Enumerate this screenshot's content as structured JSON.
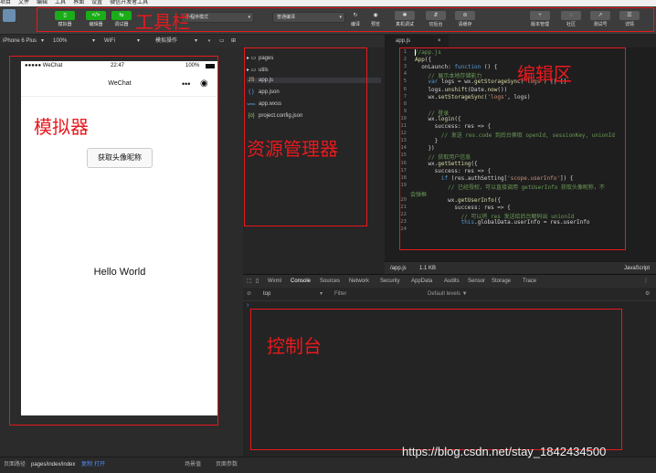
{
  "menubar": {
    "items": [
      "项目",
      "文件",
      "编辑",
      "工具",
      "界面",
      "设置",
      "微信开发者工具"
    ]
  },
  "toolbar": {
    "buttons": [
      {
        "label": "模拟器",
        "icon": "phone-icon"
      },
      {
        "label": "编辑器",
        "icon": "code-icon"
      },
      {
        "label": "调试器",
        "icon": "debug-icon"
      }
    ],
    "mode_select": "小程序模式",
    "compile_select": "普通编译",
    "compile_label": "编译",
    "preview_label": "预览",
    "remote_debug_label": "真机调试",
    "background_label": "切后台",
    "cache_label": "清缓存",
    "version_label": "版本管理",
    "community_label": "社区",
    "test_label": "测试号",
    "details_label": "详情"
  },
  "subbar": {
    "device": "iPhone 6 Plus",
    "zoom": "100%",
    "network": "WiFi",
    "sim_ops": "模拟操作"
  },
  "phone": {
    "carrier": "●●●●● WeChat",
    "time": "22:47",
    "battery": "100%",
    "nav_title": "WeChat",
    "avatar_button": "获取头像昵称",
    "hello": "Hello World"
  },
  "explorer": {
    "items": [
      {
        "name": "pages",
        "type": "folder"
      },
      {
        "name": "utils",
        "type": "folder"
      },
      {
        "name": "app.js",
        "type": "js"
      },
      {
        "name": "app.json",
        "type": "json"
      },
      {
        "name": "app.wxss",
        "type": "wxss"
      },
      {
        "name": "project.config.json",
        "type": "config"
      }
    ],
    "icons": {
      "folder": "▸",
      "js": "JS",
      "json": "{ }",
      "wxss": "wxss",
      "config": "{o}"
    }
  },
  "editor": {
    "tab": "app.js",
    "status_path": "/app.js",
    "status_size": "1.1 KB",
    "status_lang": "JavaScript",
    "lines": [
      "//app.js",
      "App({",
      "  onLaunch: function () {",
      "    // 展示本地存储能力",
      "    var logs = wx.getStorageSync('logs') || []",
      "    logs.unshift(Date.now())",
      "    wx.setStorageSync('logs', logs)",
      "",
      "    // 登录",
      "    wx.login({",
      "      success: res => {",
      "        // 发送 res.code 到后台换取 openId, sessionKey, unionId",
      "      }",
      "    })",
      "    // 获取用户信息",
      "    wx.getSetting({",
      "      success: res => {",
      "        if (res.authSetting['scope.userInfo']) {",
      "          // 已经授权，可以直接调用 getUserInfo 获取头像昵称，不",
      "会弹框",
      "          wx.getUserInfo({",
      "            success: res => {",
      "              // 可以将 res 发送给后台解码出 unionId",
      "              this.globalData.userInfo = res.userInfo",
      ""
    ],
    "line_numbers": [
      "1",
      "2",
      "3",
      "4",
      "5",
      "6",
      "7",
      "8",
      "9",
      "10",
      "11",
      "12",
      "13",
      "14",
      "15",
      "16",
      "17",
      "18",
      "19",
      "",
      "20",
      "21",
      "22",
      "23",
      "24"
    ]
  },
  "console": {
    "tabs": [
      "Wxml",
      "Console",
      "Sources",
      "Network",
      "Security",
      "AppData",
      "Audits",
      "Sensor",
      "Storage",
      "Trace"
    ],
    "active_tab": "Console",
    "context": "top",
    "filter_placeholder": "Filter",
    "levels": "Default levels ▼"
  },
  "bottombar": {
    "path_label": "页面路径",
    "path_value": "pages/index/index",
    "copy": "复制",
    "open": "打开",
    "scene": "场景值",
    "params": "页面参数"
  },
  "annotations": {
    "toolbar": "工具栏",
    "simulator": "模拟器",
    "explorer": "资源管理器",
    "editor": "编辑区",
    "console": "控制台"
  },
  "watermark": "https://blog.csdn.net/stay_1842434500",
  "colors": {
    "annotation": "#e8191e",
    "accent_green": "#1aad19"
  }
}
